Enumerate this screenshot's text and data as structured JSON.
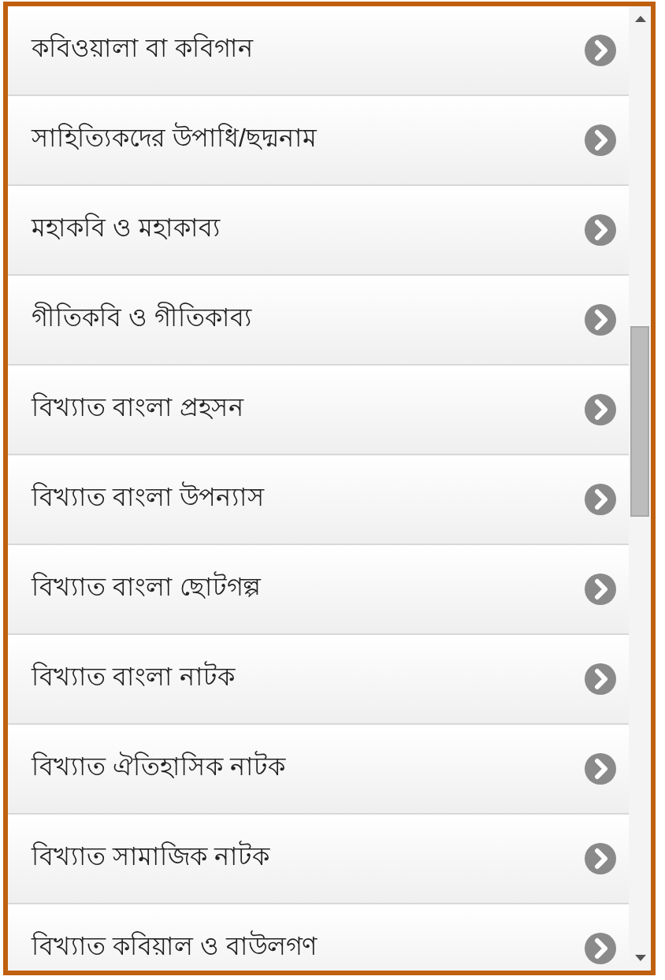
{
  "items": [
    {
      "label": "কবিওয়ালা বা কবিগান"
    },
    {
      "label": "সাহিত্যিকদের উপাধি/ছদ্মনাম"
    },
    {
      "label": "মহাকবি ও মহাকাব্য"
    },
    {
      "label": "গীতিকবি ও গীতিকাব্য"
    },
    {
      "label": "বিখ্যাত বাংলা প্রহসন"
    },
    {
      "label": "বিখ্যাত বাংলা উপন্যাস"
    },
    {
      "label": "বিখ্যাত বাংলা ছোটগল্প"
    },
    {
      "label": "বিখ্যাত বাংলা নাটক"
    },
    {
      "label": "বিখ্যাত ঐতিহাসিক নাটক"
    },
    {
      "label": "বিখ্যাত সামাজিক নাটক"
    },
    {
      "label": "বিখ্যাত কবিয়াল ও বাউলগণ"
    }
  ]
}
